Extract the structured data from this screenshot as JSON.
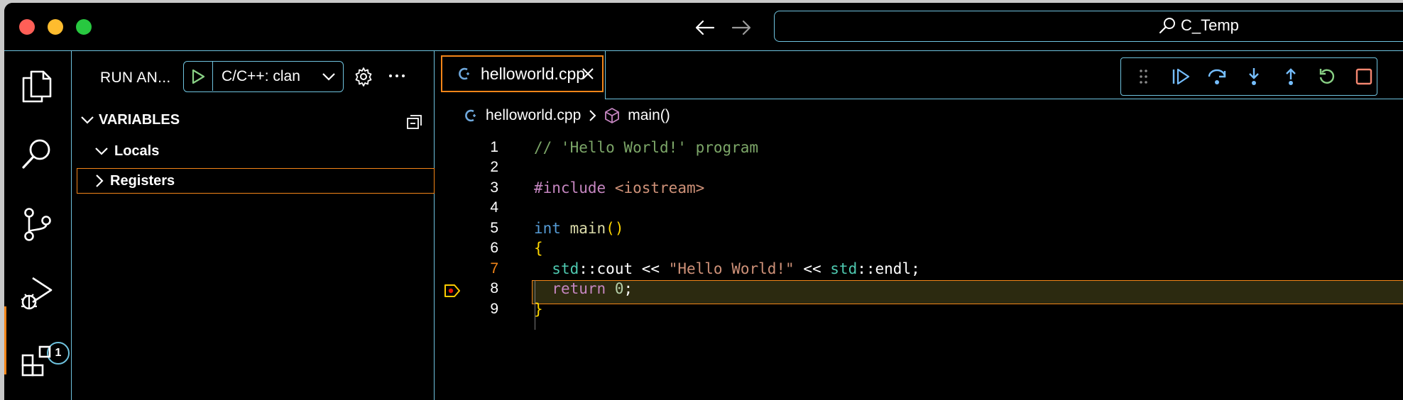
{
  "titlebar": {
    "search_text": "C_Temp"
  },
  "activity": {
    "debug_badge": "1"
  },
  "sidebar": {
    "title": "RUN AN...",
    "launch_config": "C/C++: clan",
    "variables_label": "VARIABLES",
    "tree": [
      {
        "label": "Locals",
        "expanded": true
      },
      {
        "label": "Registers",
        "expanded": false
      }
    ]
  },
  "editor": {
    "tab_label": "helloworld.cpp",
    "breadcrumb": {
      "file": "helloworld.cpp",
      "symbol": "main()"
    },
    "current_line": 7,
    "lines": [
      {
        "n": "1"
      },
      {
        "n": "2"
      },
      {
        "n": "3"
      },
      {
        "n": "4"
      },
      {
        "n": "5"
      },
      {
        "n": "6"
      },
      {
        "n": "7"
      },
      {
        "n": "8"
      },
      {
        "n": "9"
      }
    ],
    "code": {
      "l1_comment": "// 'Hello World!' program",
      "l3_directive": "#include",
      "l3_header": "<iostream>",
      "l5_type": "int",
      "l5_fn": "main",
      "l5_parens": "()",
      "l6_brace": "{",
      "l7_ns1": "std",
      "l7_sep1": "::",
      "l7_cout": "cout",
      "l7_op1": " << ",
      "l7_str": "\"Hello World!\"",
      "l7_op2": " << ",
      "l7_ns2": "std",
      "l7_sep2": "::",
      "l7_endl": "endl;",
      "l8_kw": "return",
      "l8_num": "0",
      "l8_semi": ";",
      "l9_brace": "}"
    }
  },
  "colors": {
    "contrast_border": "#6fc3df",
    "active_border": "#f38518",
    "current_line_bg": "#2c2a10"
  }
}
